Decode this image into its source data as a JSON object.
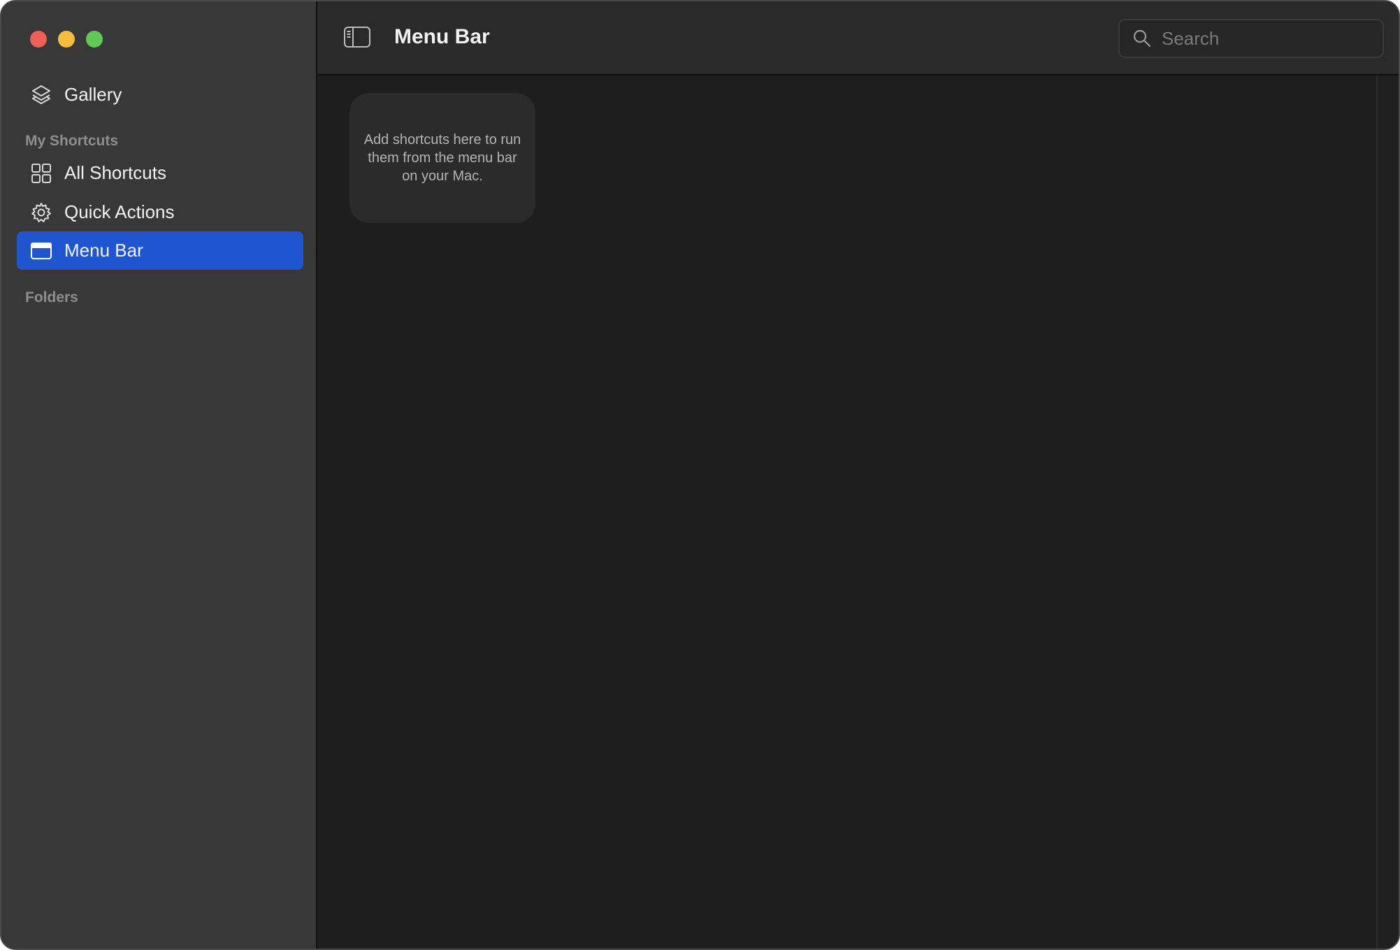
{
  "window": {
    "traffic_lights": [
      "close",
      "minimize",
      "zoom"
    ]
  },
  "sidebar": {
    "gallery": {
      "label": "Gallery",
      "icon": "layers-icon"
    },
    "my_shortcuts_header": "My Shortcuts",
    "items": [
      {
        "label": "All Shortcuts",
        "icon": "grid-icon",
        "selected": false
      },
      {
        "label": "Quick Actions",
        "icon": "gear-icon",
        "selected": false
      },
      {
        "label": "Menu Bar",
        "icon": "menubar-window-icon",
        "selected": true
      }
    ],
    "folders_header": "Folders"
  },
  "toolbar": {
    "title": "Menu Bar",
    "add_icon": "plus-icon",
    "grid_view_icon": "grid-view-icon",
    "list_view_icon": "list-view-icon",
    "search_placeholder": "Search"
  },
  "content": {
    "empty_message": "Add shortcuts here to run them from the menu bar on your Mac."
  },
  "colors": {
    "accent": "#1f56d0",
    "sidebar_bg": "#383838",
    "content_bg": "#1e1e1e",
    "toolbar_bg": "#2a2a2a"
  }
}
